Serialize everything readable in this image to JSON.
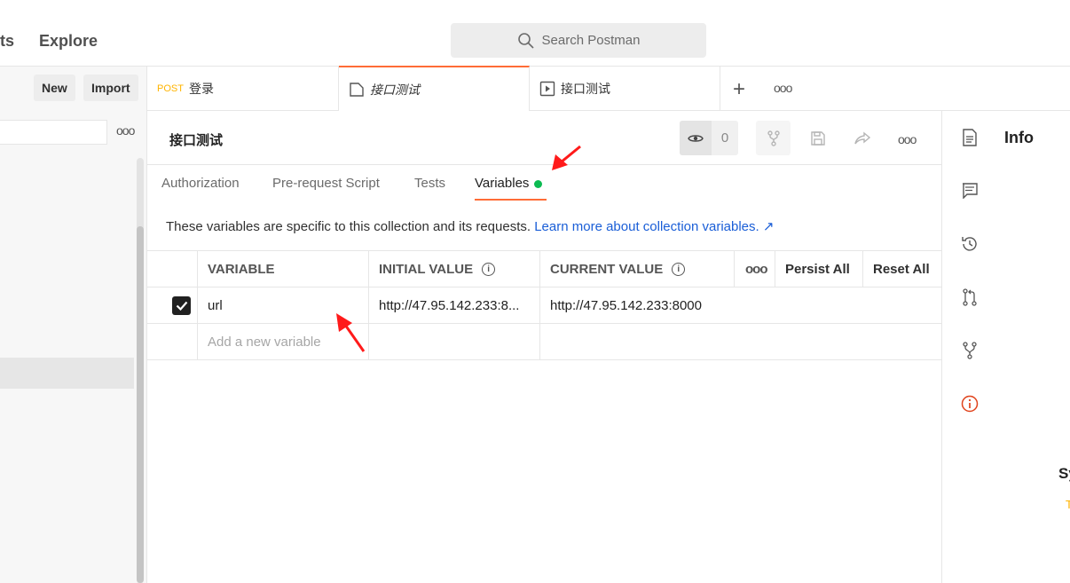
{
  "topbar": {
    "nav_partial": "ts",
    "nav_explore": "Explore",
    "search_placeholder": "Search Postman"
  },
  "sidebar": {
    "new_label": "New",
    "import_label": "Import",
    "more": "ooo"
  },
  "tabs": [
    {
      "method": "POST",
      "label": "登录"
    },
    {
      "label": "接口测试"
    },
    {
      "label": "接口测试"
    }
  ],
  "tab_actions": {
    "add": "+",
    "more": "ooo"
  },
  "collection": {
    "title": "接口测试",
    "watch_count": "0",
    "more": "ooo"
  },
  "subtabs": [
    {
      "label": "Authorization"
    },
    {
      "label": "Pre-request Script"
    },
    {
      "label": "Tests"
    },
    {
      "label": "Variables"
    }
  ],
  "description": {
    "text": "These variables are specific to this collection and its requests.",
    "link": "Learn more about collection variables. ↗"
  },
  "variables_table": {
    "headers": {
      "variable": "VARIABLE",
      "initial": "INITIAL VALUE",
      "current": "CURRENT VALUE",
      "more": "ooo",
      "persist_all": "Persist All",
      "reset_all": "Reset All"
    },
    "rows": [
      {
        "checked": true,
        "variable": "url",
        "initial": "http://47.95.142.233:8...",
        "current": "http://47.95.142.233:8000"
      }
    ],
    "new_placeholder": "Add a new variable"
  },
  "right_panel": {
    "title": "Info",
    "partial_heading": "Sy",
    "partial_text": "T"
  },
  "colors": {
    "accent": "#ff6c37",
    "active_dot": "#0cbb52",
    "link": "#1a5ed7",
    "method_post": "#ffb400",
    "annotation_arrow": "#ff1a1a"
  }
}
